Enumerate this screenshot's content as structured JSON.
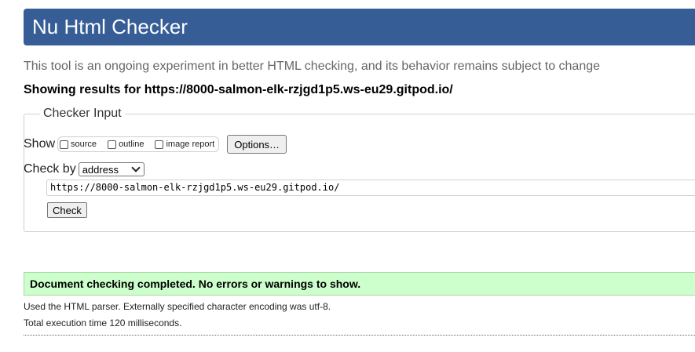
{
  "header": {
    "title": "Nu Html Checker"
  },
  "tagline": "This tool is an ongoing experiment in better HTML checking, and its behavior remains subject to change",
  "showing": "Showing results for https://8000-salmon-elk-rzjgd1p5.ws-eu29.gitpod.io/",
  "checker_input": {
    "legend": "Checker Input",
    "show_label": "Show",
    "checkboxes": [
      {
        "label": "source",
        "checked": false
      },
      {
        "label": "outline",
        "checked": false
      },
      {
        "label": "image report",
        "checked": false
      }
    ],
    "options_button": "Options…",
    "check_by_label": "Check by",
    "check_by_selected": "address",
    "url_value": "https://8000-salmon-elk-rzjgd1p5.ws-eu29.gitpod.io/",
    "check_button": "Check"
  },
  "result": {
    "message": "Document checking completed. No errors or warnings to show.",
    "parser_info": "Used the HTML parser. Externally specified character encoding was utf-8.",
    "execution_time": "Total execution time 120 milliseconds."
  },
  "colors": {
    "header_bg": "#365d95",
    "success_bg": "#ccffcc"
  }
}
